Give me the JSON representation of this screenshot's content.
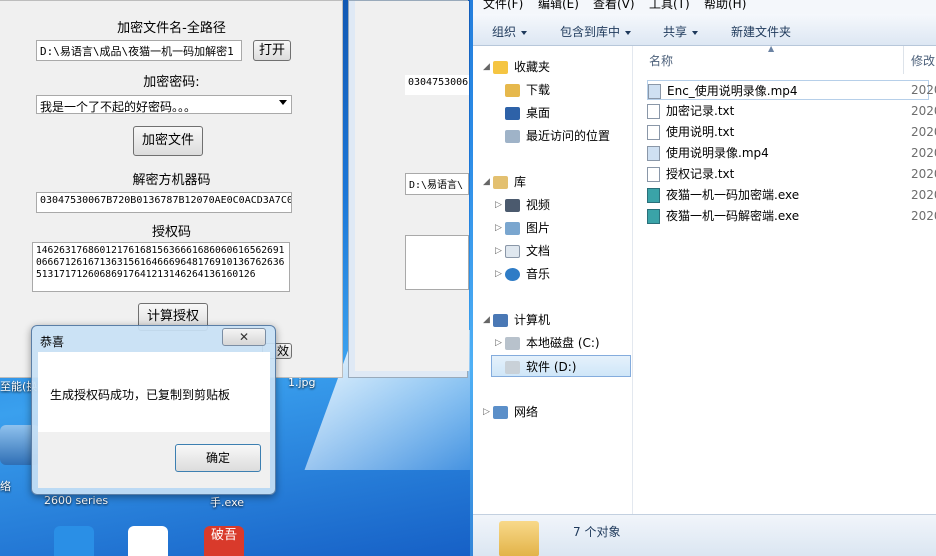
{
  "encrypt_app": {
    "label_file": "加密文件名-全路径",
    "file_path": "D:\\易语言\\成品\\夜猫一机一码加解密1",
    "open_button": "打开",
    "label_password": "加密密码:",
    "password_value": "我是一个了不起的好密码。。。",
    "encrypt_button": "加密文件",
    "label_machine_code": "解密方机器码",
    "machine_code": "03047530067B720B0136787B12070AE0C0ACD3A7C0",
    "label_auth_code": "授权码",
    "auth_code": "1462631768601217616815636661686060616562691066671261671363156164666964817691013676263651317171260686917641213146264136160126",
    "calc_button": "计算授权",
    "clipped_text": "效"
  },
  "middle_window": {
    "code_snippet": "0304753006",
    "path_snippet": "D:\\易语言\\"
  },
  "dialog": {
    "title": "恭喜",
    "close_symbol": "✕",
    "message": "生成授权码成功，已复制到剪贴板",
    "ok_button": "确定"
  },
  "desktop_labels": {
    "exchanger": "至能(换器",
    "network": "络",
    "printer": "2600 series",
    "jpg": "1.jpg",
    "exe": "手.exe",
    "poxiao": "破吾"
  },
  "explorer": {
    "menu": [
      "文件(F)",
      "编辑(E)",
      "查看(V)",
      "工具(T)",
      "帮助(H)"
    ],
    "toolbar": [
      "组织",
      "包含到库中",
      "共享",
      "新建文件夹"
    ],
    "nav": {
      "favorites": "收藏夹",
      "downloads": "下载",
      "desktop": "桌面",
      "recent": "最近访问的位置",
      "libraries": "库",
      "videos": "视频",
      "pictures": "图片",
      "documents": "文档",
      "music": "音乐",
      "computer": "计算机",
      "local_disk": "本地磁盘 (C:)",
      "software_disk": "软件 (D:)",
      "network": "网络"
    },
    "columns": {
      "name": "名称",
      "modified": "修改"
    },
    "files": [
      {
        "name": "Enc_使用说明录像.mp4",
        "date": "2020",
        "type": "video"
      },
      {
        "name": "加密记录.txt",
        "date": "2020",
        "type": "text"
      },
      {
        "name": "使用说明.txt",
        "date": "2020",
        "type": "text"
      },
      {
        "name": "使用说明录像.mp4",
        "date": "2020",
        "type": "video"
      },
      {
        "name": "授权记录.txt",
        "date": "2020",
        "type": "text"
      },
      {
        "name": "夜猫一机一码加密端.exe",
        "date": "2020",
        "type": "exe"
      },
      {
        "name": "夜猫一机一码解密端.exe",
        "date": "2020",
        "type": "exe"
      }
    ],
    "status": "7 个对象"
  },
  "colors": {
    "desktop_blue": "#1b77d8",
    "window_bg": "#f0f0f0",
    "selection": "#cfe6f8",
    "folder_yellow": "#e2b247"
  }
}
